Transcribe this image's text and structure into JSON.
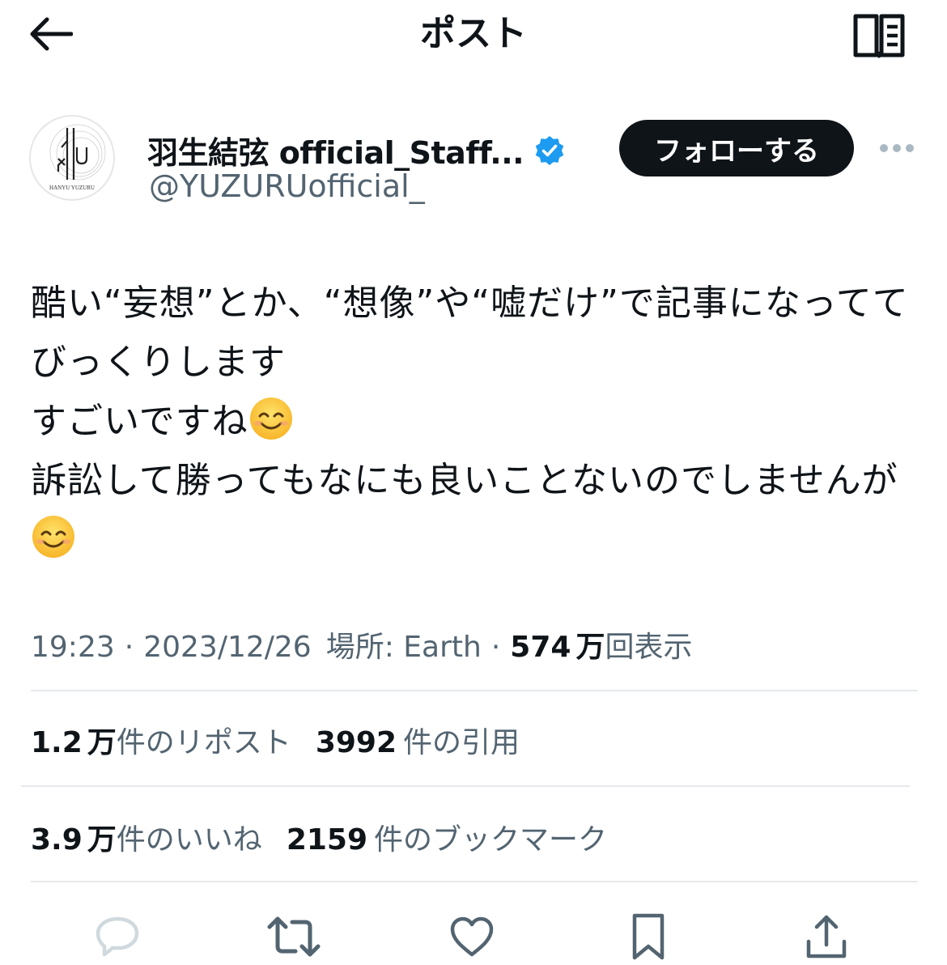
{
  "header": {
    "title": "ポスト",
    "back_icon": "arrow-left-icon",
    "reader_icon": "book-icon"
  },
  "author": {
    "display_name": "羽生結弦 official_Staff...",
    "handle": "@YUZURUofficial_",
    "verified": true,
    "avatar_text": "HANYU YUZURU",
    "follow_label": "フォローする"
  },
  "tweet": {
    "lines": [
      "酷い“妄想”とか、“想像”や“嘘だけ”で記事になってて",
      "びっくりします",
      "すごいですね",
      "訴訟して勝ってもなにも良いことないのでしませんが"
    ],
    "emoji": "smiling-face-icon"
  },
  "meta": {
    "time": "19:23",
    "date": "2023/12/26",
    "location": "場所: Earth",
    "views_number": "574",
    "views_unit": "万",
    "views_label": "回表示",
    "separator": "·"
  },
  "stats": {
    "reposts_num": "1.2",
    "reposts_unit": "万",
    "reposts_label": "件のリポスト",
    "quotes_num": "3992",
    "quotes_label": "件の引用",
    "likes_num": "3.9",
    "likes_unit": "万",
    "likes_label": "件のいいね",
    "bookmarks_num": "2159",
    "bookmarks_label": "件のブックマーク"
  },
  "actions": [
    "reply-icon",
    "repost-icon",
    "like-icon",
    "bookmark-icon",
    "share-icon"
  ],
  "colors": {
    "text": "#0f1419",
    "secondary": "#536471",
    "verified": "#1d9bf0",
    "follow_bg": "#0f1419",
    "divider": "#e6e9ec"
  }
}
